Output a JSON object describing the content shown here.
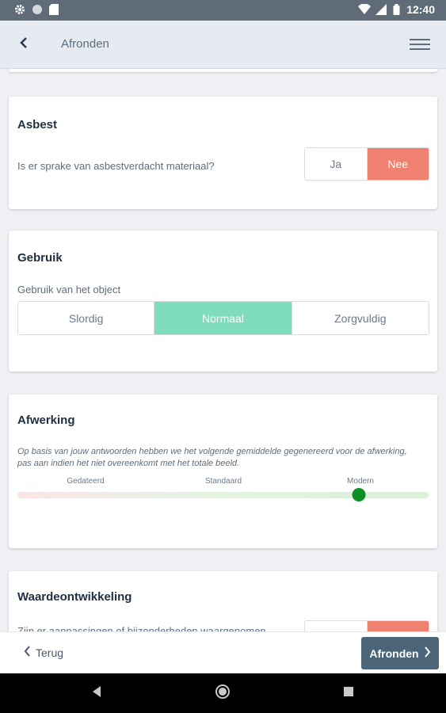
{
  "status_bar": {
    "time": "12:40",
    "icons_left": [
      "gear-icon",
      "circle-icon",
      "sd-card-icon"
    ],
    "icons_right": [
      "wifi-icon",
      "signal-icon",
      "battery-icon"
    ]
  },
  "app_bar": {
    "title": "Afronden",
    "back_icon": "chevron-left-icon",
    "menu_icon": "hamburger-menu-icon"
  },
  "asbest": {
    "title": "Asbest",
    "question": "Is er sprake van asbestverdacht materiaal?",
    "options": [
      "Ja",
      "Nee"
    ],
    "selected": "Nee"
  },
  "gebruik": {
    "title": "Gebruik",
    "question": "Gebruik van het object",
    "options": [
      "Slordig",
      "Normaal",
      "Zorgvuldig"
    ],
    "selected": "Normaal"
  },
  "afwerking": {
    "title": "Afwerking",
    "description": "Op basis van jouw antwoorden hebben we het volgende gemiddelde gegenereerd voor de afwerking, pas aan indien het niet overeenkomt met het totale beeld.",
    "scale_labels": [
      "Gedateerd",
      "Standaard",
      "Modern"
    ],
    "slider_value": 0.83
  },
  "waardeontwikkeling": {
    "title": "Waardeontwikkeling",
    "question": "Zijn er aanpassingen of bijzonderheden waargenomen"
  },
  "footer": {
    "back_label": "Terug",
    "finish_label": "Afronden"
  },
  "colors": {
    "accent_red": "#f0806f",
    "accent_green": "#7fdcbc",
    "slider_thumb": "#0c8f23",
    "primary_button": "#4b6478"
  }
}
